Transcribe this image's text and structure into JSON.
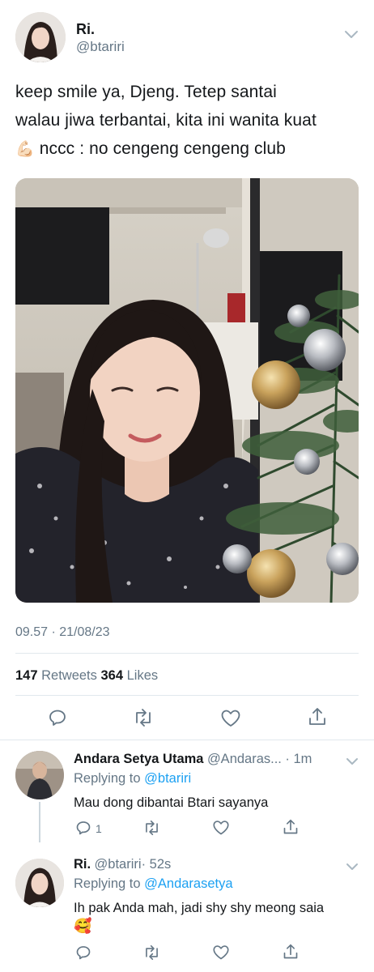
{
  "tweet": {
    "author_name": "Ri.",
    "author_handle": "@btariri",
    "text_line1": "keep smile ya, Djeng. Tetep santai",
    "text_line2": "walau jiwa terbantai, kita ini wanita kuat",
    "text_line3_emoji": "💪🏻",
    "text_line3": " nccc : no cengeng cengeng club",
    "timestamp": "09.57 · 21/08/23",
    "retweets_count": "147",
    "retweets_label": " Retweets ",
    "likes_count": "364",
    "likes_label": " Likes"
  },
  "replies": [
    {
      "author_name": "Andara Setya Utama",
      "author_handle": "@Andaras...",
      "time": "· 1m",
      "replying_prefix": "Replying to ",
      "replying_to": "@btariri",
      "text": "Mau dong dibantai Btari sayanya",
      "reply_count": "1"
    },
    {
      "author_name": "Ri.",
      "author_handle": "@btariri",
      "time": "· 52s",
      "replying_prefix": "Replying to ",
      "replying_to": "@Andarasetya",
      "text": "Ih pak Anda mah, jadi shy shy meong saia",
      "emoji": "🥰"
    }
  ],
  "icons": {
    "reply": "reply-icon",
    "retweet": "retweet-icon",
    "like": "heart-icon",
    "share": "share-icon",
    "more": "chevron-down-icon"
  },
  "colors": {
    "link": "#1da1f2",
    "secondary": "#657786",
    "divider": "#e1e8ed"
  }
}
